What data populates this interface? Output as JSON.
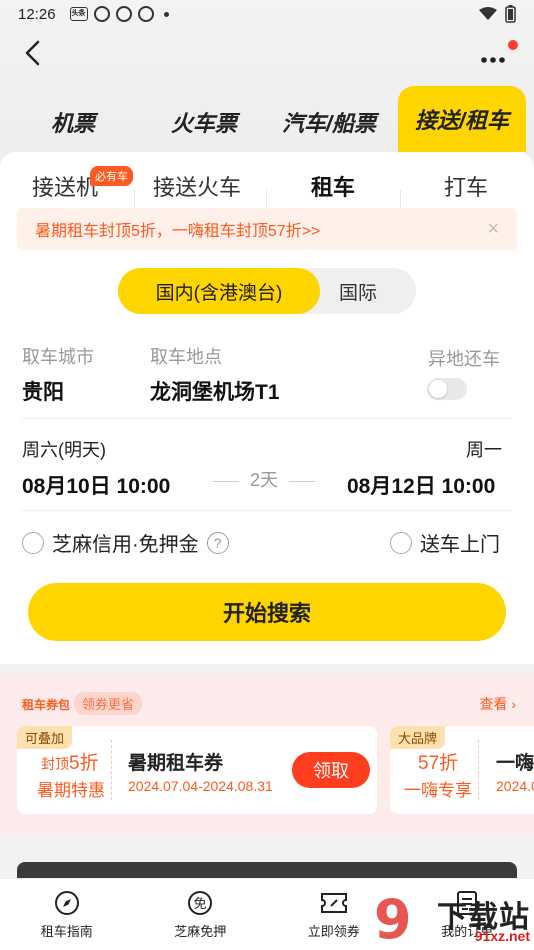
{
  "status_bar": {
    "time": "12:26",
    "chip_label": "头条"
  },
  "category_tabs": [
    {
      "label": "机票"
    },
    {
      "label": "火车票"
    },
    {
      "label": "汽车/船票"
    },
    {
      "label": "接送/租车"
    }
  ],
  "sub_tabs": [
    {
      "label": "接送机"
    },
    {
      "label": "接送火车"
    },
    {
      "label": "租车"
    },
    {
      "label": "打车"
    }
  ],
  "sub_tab_badge": "必有车",
  "promo_banner": {
    "text": "暑期租车封顶5折，一嗨租车封顶57折>>",
    "close": "×"
  },
  "region_toggle": {
    "domestic": "国内(含港澳台)",
    "international": "国际"
  },
  "pickup": {
    "city_label": "取车城市",
    "city_value": "贵阳",
    "location_label": "取车地点",
    "location_value": "龙洞堡机场T1",
    "return_diff_label": "异地还车"
  },
  "dates": {
    "start_weekday": "周六(明天)",
    "start_datetime": "08月10日 10:00",
    "duration": "2天",
    "end_weekday": "周一",
    "end_datetime": "08月12日 10:00"
  },
  "options": {
    "zhima_label": "芝麻信用·免押金",
    "zhima_help": "?",
    "delivery_label": "送车上门"
  },
  "search_button": "开始搜索",
  "coupon_section": {
    "title": "租车券包",
    "tag": "领券更省",
    "more": "查看 ›",
    "coupons": [
      {
        "tag": "可叠加",
        "prefix": "封顶",
        "value": "5折",
        "subtitle": "暑期特惠",
        "name": "暑期租车券",
        "date": "2024.07.04-2024.08.31",
        "button": "领取"
      },
      {
        "tag": "大品牌",
        "value": "57折",
        "subtitle": "一嗨专享",
        "name": "一嗨",
        "date": "2024.0"
      }
    ]
  },
  "bottom_nav": [
    {
      "label": "租车指南",
      "icon": "compass-icon"
    },
    {
      "label": "芝麻免押",
      "icon": "mian-icon"
    },
    {
      "label": "立即领券",
      "icon": "ticket-icon"
    },
    {
      "label": "我的订单",
      "icon": "order-icon"
    }
  ],
  "watermark": {
    "text": "下载站",
    "url": "91xz.net"
  },
  "colors": {
    "brand_yellow": "#ffd500",
    "accent_orange": "#ff5a1f",
    "claim_red": "#ff3d1f"
  }
}
